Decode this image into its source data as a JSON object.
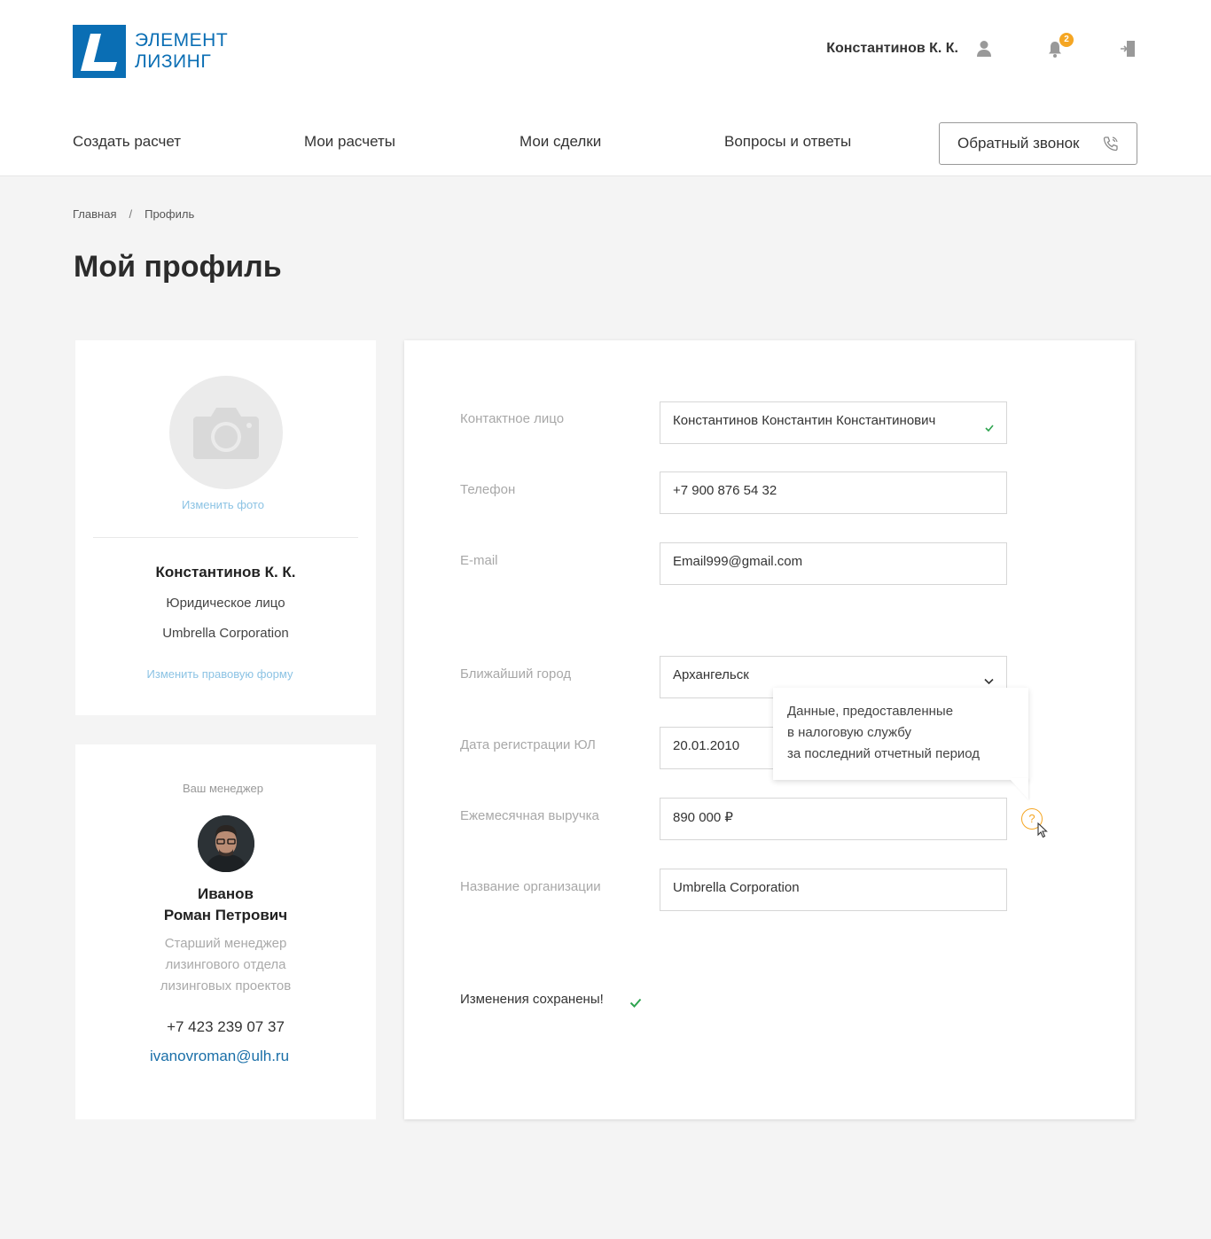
{
  "brand": {
    "line1": "ЭЛЕМЕНТ",
    "line2": "ЛИЗИНГ",
    "color": "#0a6eb4"
  },
  "user": {
    "name": "Константинов К. К.",
    "notifications": "2"
  },
  "nav": {
    "items": [
      "Создать расчет",
      "Мои расчеты",
      "Мои сделки",
      "Вопросы и ответы"
    ],
    "callback": "Обратный звонок"
  },
  "breadcrumb": {
    "home": "Главная",
    "separator": "/",
    "current": "Профиль"
  },
  "page": {
    "title": "Мой профиль"
  },
  "profile": {
    "change_photo": "Изменить фото",
    "name": "Константинов К. К.",
    "type": "Юридическое лицо",
    "org": "Umbrella Corporation",
    "change_form": "Изменить правовую форму"
  },
  "manager": {
    "label": "Ваш менеджер",
    "name_line1": "Иванов",
    "name_line2": "Роман Петрович",
    "position_line1": "Старший менеджер",
    "position_line2": "лизингового отдела",
    "position_line3": "лизинговых проектов",
    "phone": "+7 423 239 07 37",
    "email": "ivanovroman@ulh.ru"
  },
  "form": {
    "contact": {
      "label": "Контактное лицо",
      "value": "Константинов Константин Константинович"
    },
    "phone": {
      "label": "Телефон",
      "value": "+7 900 876 54 32"
    },
    "email": {
      "label": "E-mail",
      "value": "Email999@gmail.com"
    },
    "city": {
      "label": "Ближайший город",
      "value": "Архангельск"
    },
    "reg_date": {
      "label": "Дата регистрации ЮЛ",
      "value": "20.01.2010"
    },
    "revenue": {
      "label": "Ежемесячная выручка",
      "value": "890 000 ₽"
    },
    "org_name": {
      "label": "Название организации",
      "value": "Umbrella Corporation"
    }
  },
  "tooltip": {
    "line1": "Данные, предоставленные",
    "line2": "в налоговую службу",
    "line3": "за последний отчетный период"
  },
  "help": "?",
  "status": {
    "saved": "Изменения сохранены!"
  },
  "colors": {
    "accent": "#0a6eb4",
    "link": "#8cc3e4",
    "warning": "#f5a623",
    "success": "#2ea44f"
  }
}
